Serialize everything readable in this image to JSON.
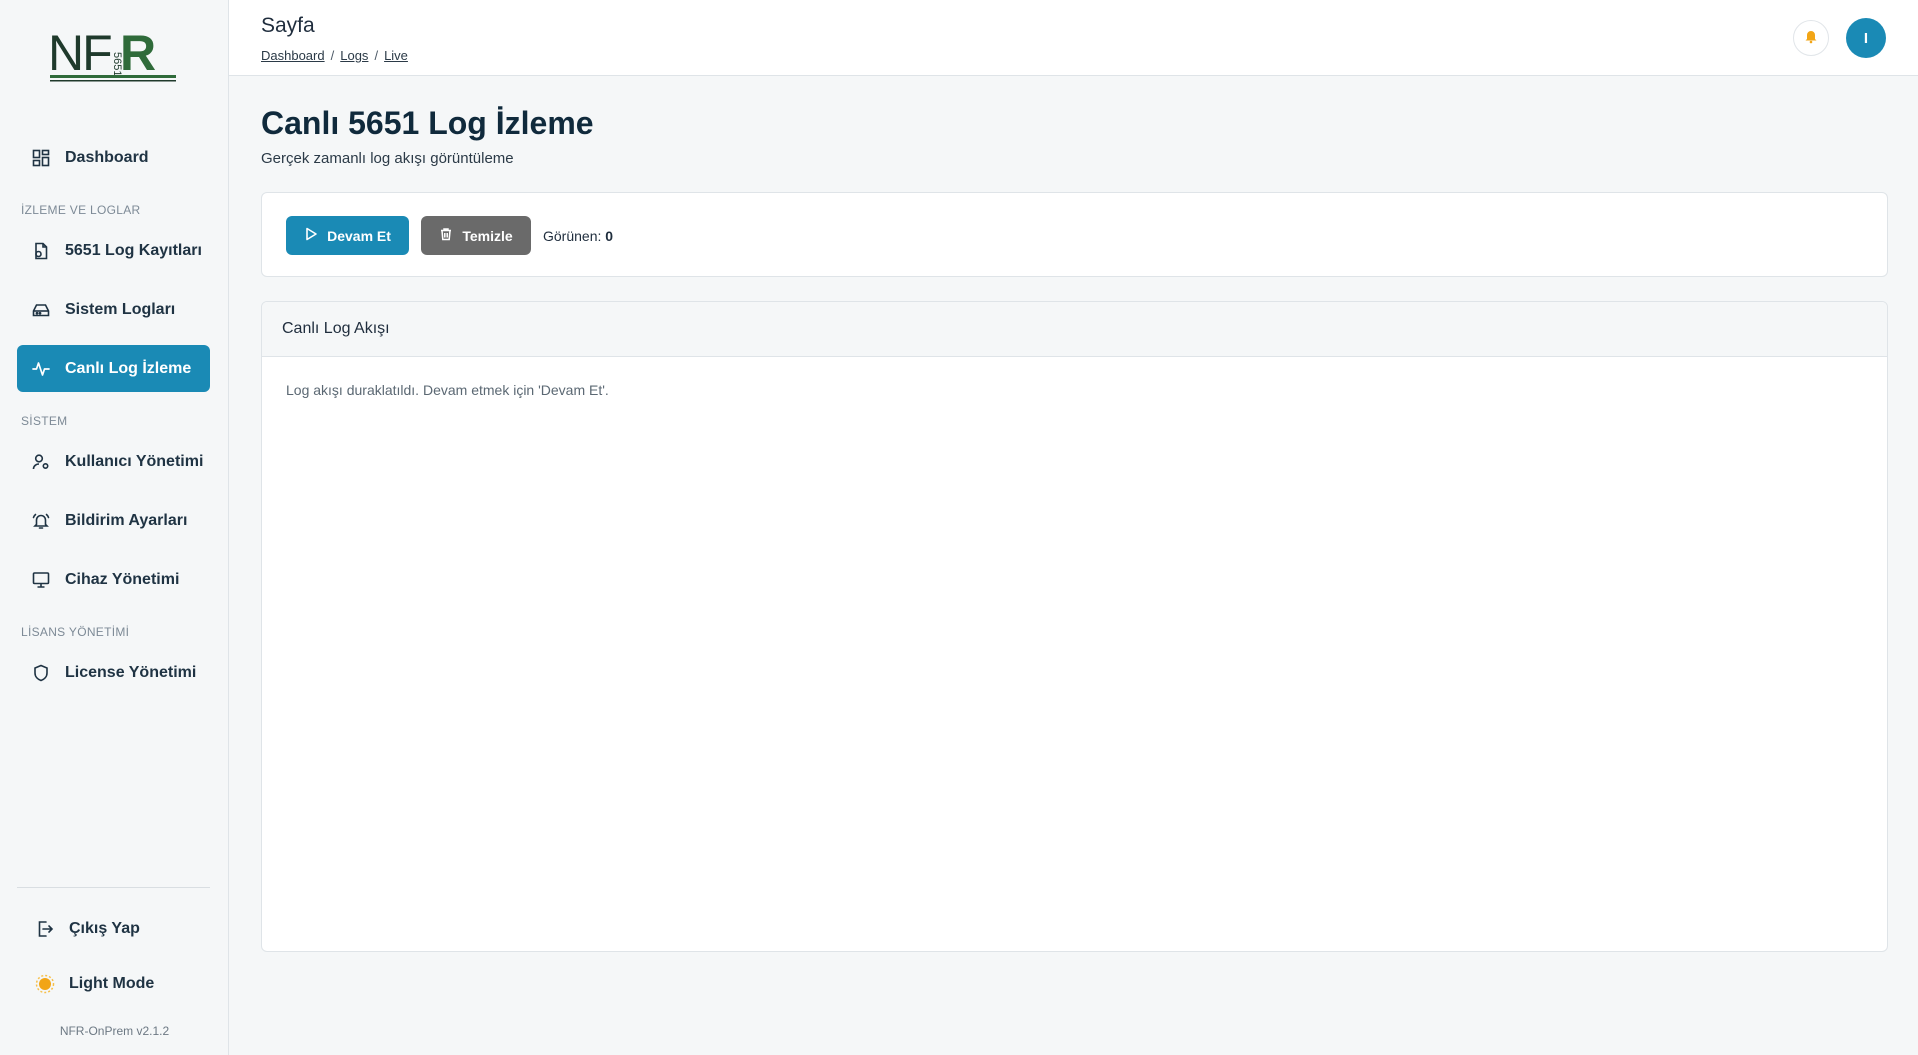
{
  "sidebar": {
    "logo_text": "NFR 5651",
    "dashboard": "Dashboard",
    "section_monitoring": "İZLEME VE LOGLAR",
    "log_records": "5651 Log Kayıtları",
    "system_logs": "Sistem Logları",
    "live_monitoring": "Canlı Log İzleme",
    "section_system": "SİSTEM",
    "user_management": "Kullanıcı Yönetimi",
    "notification_settings": "Bildirim Ayarları",
    "device_management": "Cihaz Yönetimi",
    "section_license": "LİSANS YÖNETİMİ",
    "license_management": "License Yönetimi",
    "logout": "Çıkış Yap",
    "theme_toggle": "Light Mode",
    "version": "NFR-OnPrem v2.1.2",
    "accent_color": "#1a8ab5"
  },
  "header": {
    "page_name": "Sayfa",
    "breadcrumb": [
      "Dashboard",
      "Logs",
      "Live"
    ],
    "breadcrumb_sep": "/",
    "avatar_initial": "I",
    "notification_icon": "bell-icon"
  },
  "main": {
    "title": "Canlı 5651 Log İzleme",
    "subtitle": "Gerçek zamanlı log akışı görüntüleme",
    "controls": {
      "resume_label": "Devam Et",
      "clear_label": "Temizle",
      "seen_label": "Görünen:",
      "seen_count": "0"
    },
    "stream": {
      "header": "Canlı Log Akışı",
      "message": "Log akışı duraklatıldı. Devam etmek için 'Devam Et'."
    }
  }
}
